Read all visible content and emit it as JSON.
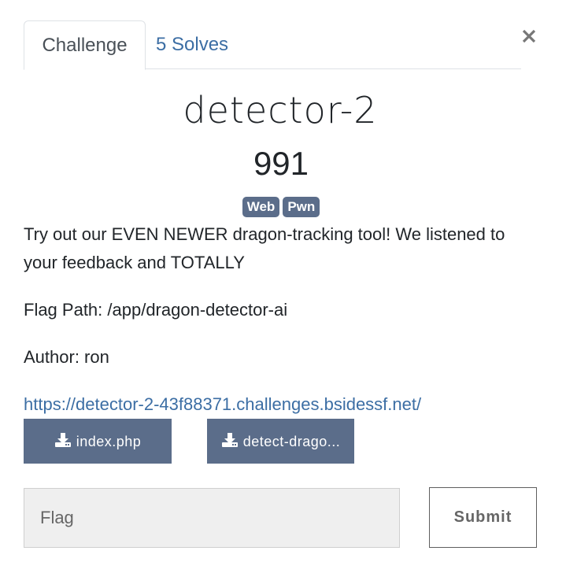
{
  "tabs": [
    {
      "label": "Challenge",
      "active": true
    },
    {
      "label": "5 Solves",
      "active": false
    }
  ],
  "close_icon": "close-icon",
  "challenge": {
    "name": "detector-2",
    "value": "991",
    "tags": [
      "Web",
      "Pwn"
    ],
    "description": [
      "Try out our EVEN NEWER dragon-tracking tool! We listened to your feedback and TOTALLY",
      "Flag Path: /app/dragon-detector-ai",
      "Author: ron"
    ],
    "link": "https://detector-2-43f88371.challenges.bsidessf.net/"
  },
  "files": [
    {
      "label": "index.php",
      "icon": "download-icon"
    },
    {
      "label": "detect-drago...",
      "icon": "download-icon"
    }
  ],
  "form": {
    "flag_placeholder": "Flag",
    "flag_value": "",
    "submit_label": "Submit"
  },
  "colors": {
    "accent": "#5b6d8a",
    "link": "#3c6ea4"
  }
}
